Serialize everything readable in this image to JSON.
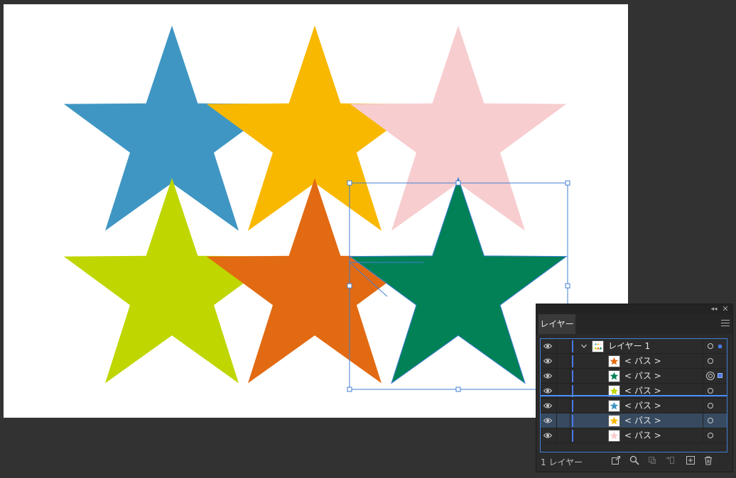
{
  "colors": {
    "app_bg": "#323232",
    "artboard": "#ffffff",
    "selection": "#3f7fd6",
    "star_blue": "#3f96c3",
    "star_yellow": "#f9b800",
    "star_pink": "#f7cdcf",
    "star_lime": "#bfd600",
    "star_orange": "#e26a12",
    "star_green": "#028157"
  },
  "canvas": {
    "stars": [
      {
        "name": "blue",
        "color": "#3f96c3"
      },
      {
        "name": "yellow",
        "color": "#f9b800"
      },
      {
        "name": "pink",
        "color": "#f7cdcf"
      },
      {
        "name": "lime",
        "color": "#bfd600"
      },
      {
        "name": "orange",
        "color": "#e26a12"
      },
      {
        "name": "green",
        "color": "#028157",
        "selected": true
      }
    ]
  },
  "layers_panel": {
    "tab_label": "レイヤー",
    "collapse_icon": "double-chevron-left-icon",
    "close_icon": "close-icon",
    "menu_icon": "hamburger-menu-icon",
    "layer": {
      "name": "レイヤー 1",
      "expanded": true
    },
    "paths": [
      {
        "name": "< パス >",
        "thumb_color": "#e26a12",
        "selected": false,
        "has_art_selected": false
      },
      {
        "name": "< パス >",
        "thumb_color": "#028157",
        "selected": false,
        "has_art_selected": true
      },
      {
        "name": "< パス >",
        "thumb_color": "#bfd600",
        "selected": false,
        "has_art_selected": false
      },
      {
        "name": "< パス >",
        "thumb_color": "#3f96c3",
        "selected": false,
        "has_art_selected": false
      },
      {
        "name": "< パス >",
        "thumb_color": "#f9b800",
        "selected": true,
        "has_art_selected": false
      },
      {
        "name": "< パス >",
        "thumb_color": "#f7cdcf",
        "selected": false,
        "has_art_selected": false
      }
    ],
    "footer": {
      "count_label": "1 レイヤー",
      "icons": [
        "export-icon",
        "search-icon",
        "clipping-mask-icon",
        "sublayer-icon",
        "new-layer-icon",
        "trash-icon"
      ]
    }
  }
}
